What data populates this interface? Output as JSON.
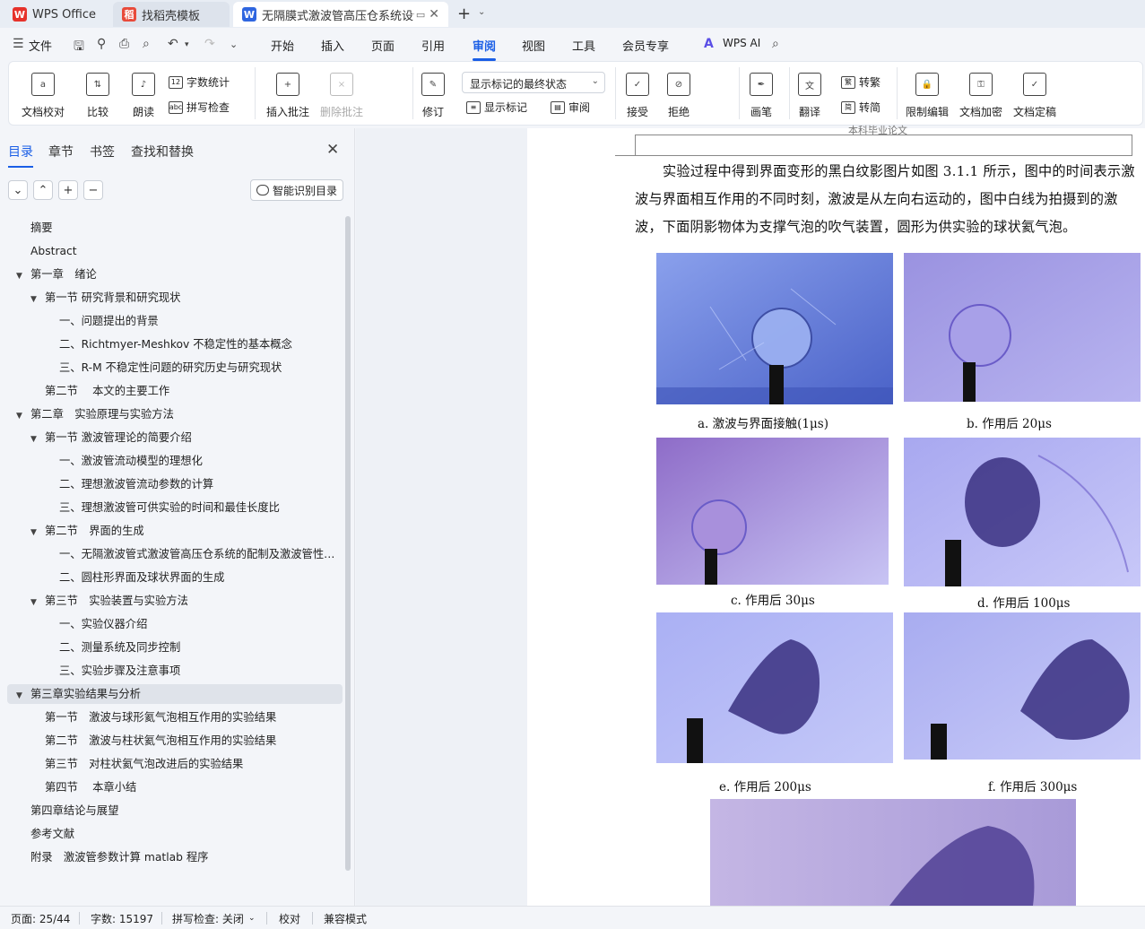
{
  "tabs": [
    {
      "label": "WPS Office",
      "icon": "wps-logo-icon"
    },
    {
      "label": "找稻壳模板",
      "icon": "docer-icon"
    },
    {
      "label": "无隔膜式激波管高压仓系统设计",
      "icon": "writer-doc-icon"
    }
  ],
  "menu": {
    "file": "文件",
    "items": [
      "开始",
      "插入",
      "页面",
      "引用",
      "审阅",
      "视图",
      "工具",
      "会员专享"
    ],
    "active": "审阅",
    "wps_ai": "WPS AI"
  },
  "ribbon": {
    "doc_check": "文档校对",
    "compare": "比较",
    "read_aloud": "朗读",
    "word_count": "字数统计",
    "spell_check": "拼写检查",
    "insert_comment": "插入批注",
    "delete_comment": "删除批注",
    "track_changes": "修订",
    "markup_state": "显示标记的最终状态",
    "show_markup": "显示标记",
    "review": "审阅",
    "accept": "接受",
    "reject": "拒绝",
    "ink": "画笔",
    "translate": "翻译",
    "to_traditional": "转繁",
    "to_simplified": "转简",
    "restrict_edit": "限制编辑",
    "encrypt": "文档加密",
    "finalize": "文档定稿"
  },
  "nav": {
    "tabs": [
      "目录",
      "章节",
      "书签",
      "查找和替换"
    ],
    "active_tab": "目录",
    "smart_toc": "智能识别目录",
    "toc": [
      {
        "text": "摘要",
        "level": 0,
        "arrow": ""
      },
      {
        "text": "Abstract",
        "level": 0,
        "arrow": ""
      },
      {
        "text": "第一章　绪论",
        "level": 0,
        "arrow": "▼"
      },
      {
        "text": "第一节  研究背景和研究现状",
        "level": 1,
        "arrow": "▼"
      },
      {
        "text": "一、问题提出的背景",
        "level": 2,
        "arrow": ""
      },
      {
        "text": "二、Richtmyer-Meshkov 不稳定性的基本概念",
        "level": 2,
        "arrow": ""
      },
      {
        "text": "三、R-M 不稳定性问题的研究历史与研究现状",
        "level": 2,
        "arrow": ""
      },
      {
        "text": "第二节　 本文的主要工作",
        "level": 1,
        "arrow": ""
      },
      {
        "text": "第二章　实验原理与实验方法",
        "level": 0,
        "arrow": "▼"
      },
      {
        "text": "第一节  激波管理论的简要介绍",
        "level": 1,
        "arrow": "▼"
      },
      {
        "text": "一、激波管流动模型的理想化",
        "level": 2,
        "arrow": ""
      },
      {
        "text": "二、理想激波管流动参数的计算",
        "level": 2,
        "arrow": ""
      },
      {
        "text": "三、理想激波管可供实验的时间和最佳长度比",
        "level": 2,
        "arrow": ""
      },
      {
        "text": "第二节　界面的生成",
        "level": 1,
        "arrow": "▼"
      },
      {
        "text": "一、无隔激波管式激波管高压仓系统的配制及激波管性能测试",
        "level": 2,
        "arrow": ""
      },
      {
        "text": "二、圆柱形界面及球状界面的生成",
        "level": 2,
        "arrow": ""
      },
      {
        "text": "第三节　实验装置与实验方法",
        "level": 1,
        "arrow": "▼"
      },
      {
        "text": "一、实验仪器介绍",
        "level": 2,
        "arrow": ""
      },
      {
        "text": "二、测量系统及同步控制",
        "level": 2,
        "arrow": ""
      },
      {
        "text": "三、实验步骤及注意事项",
        "level": 2,
        "arrow": ""
      },
      {
        "text": "第三章实验结果与分析",
        "level": 0,
        "arrow": "▼",
        "selected": true
      },
      {
        "text": "第一节　激波与球形氦气泡相互作用的实验结果",
        "level": 1,
        "arrow": ""
      },
      {
        "text": "第二节　激波与柱状氦气泡相互作用的实验结果",
        "level": 1,
        "arrow": ""
      },
      {
        "text": "第三节　对柱状氦气泡改进后的实验结果",
        "level": 1,
        "arrow": ""
      },
      {
        "text": "第四节　 本章小结",
        "level": 1,
        "arrow": ""
      },
      {
        "text": "第四章结论与展望",
        "level": 0,
        "arrow": ""
      },
      {
        "text": "参考文献",
        "level": 0,
        "arrow": ""
      },
      {
        "text": "附录　激波管参数计算 matlab 程序",
        "level": 0,
        "arrow": ""
      }
    ]
  },
  "document": {
    "header_text": "本科毕业论文",
    "paragraph": "实验过程中得到界面变形的黑白纹影图片如图 3.1.1 所示，图中的时间表示激波与界面相互作用的不同时刻，激波是从左向右运动的，图中白线为拍摄到的激波，下面阴影物体为支撑气泡的吹气装置，圆形为供实验的球状氦气泡。",
    "captions": [
      "a. 激波与界面接触(1μs)",
      "b. 作用后 20μs",
      "c. 作用后 30μs",
      "d. 作用后 100μs",
      "e. 作用后 200μs",
      "f. 作用后 300μs"
    ]
  },
  "status": {
    "page": "页面: 25/44",
    "words": "字数: 15197",
    "spell": "拼写检查: 关闭",
    "proof": "校对",
    "compat": "兼容模式"
  },
  "colors": {
    "accent": "#1a5ee6",
    "photo_blue": "#6a7ee0",
    "photo_violet": "#a596e6"
  }
}
